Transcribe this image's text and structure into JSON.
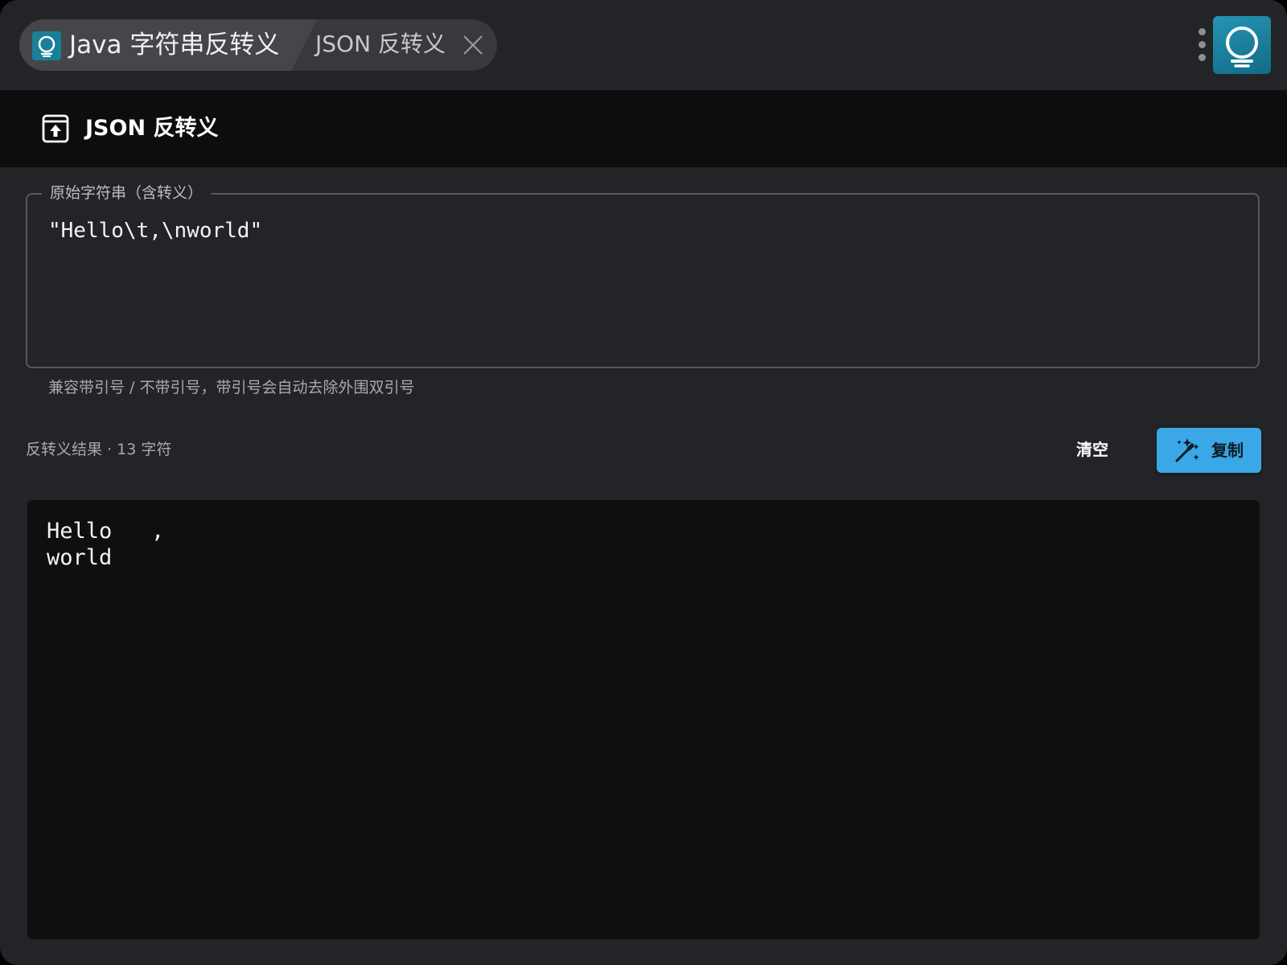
{
  "tabs": [
    {
      "label": "Java 字符串反转义",
      "active": true,
      "icon": "app-logo-icon"
    },
    {
      "label": "JSON 反转义",
      "active": false,
      "close_icon": "close-icon"
    }
  ],
  "window_controls": {
    "menu_icon": "kebab-menu-icon",
    "logo_icon": "app-logo-icon"
  },
  "header": {
    "icon": "archive-upload-icon",
    "title": "JSON 反转义"
  },
  "input": {
    "legend": "原始字符串（含转义）",
    "value": "\"Hello\\t,\\nworld\"",
    "helper": "兼容带引号 / 不带引号，带引号会自动去除外围双引号"
  },
  "result": {
    "label": "反转义结果 · 13 字符",
    "clear_label": "清空",
    "copy_label": "复制",
    "copy_icon": "magic-wand-icon",
    "output": "Hello\t,\nworld"
  },
  "colors": {
    "window_bg": "#232427",
    "header_bg": "#0d0d0e",
    "output_bg": "#0f0f10",
    "accent": "#3aa7e6",
    "logo": "#1a7f98"
  }
}
